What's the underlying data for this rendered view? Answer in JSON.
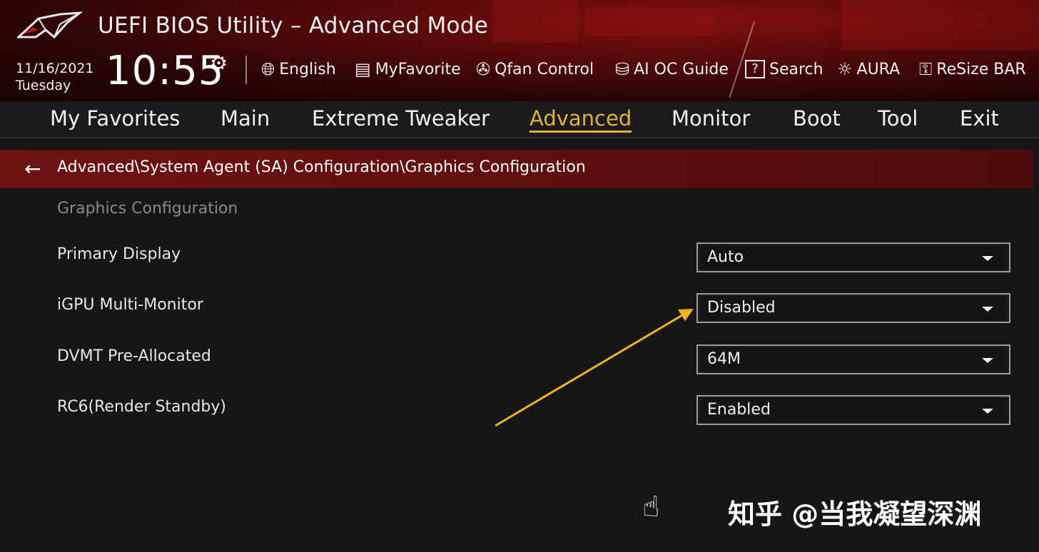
{
  "header": {
    "title": "UEFI BIOS Utility – Advanced Mode",
    "date": "11/16/2021",
    "day": "Tuesday",
    "time": "10:55",
    "tools": [
      {
        "icon": "globe-icon",
        "label": "English"
      },
      {
        "icon": "favorite-list-icon",
        "label": "MyFavorite"
      },
      {
        "icon": "fan-icon",
        "label": "Qfan Control"
      },
      {
        "icon": "ai-oc-icon",
        "label": "AI OC Guide"
      },
      {
        "icon": "question-box-icon",
        "label": "Search"
      },
      {
        "icon": "aura-light-icon",
        "label": "AURA"
      },
      {
        "icon": "resize-bar-icon",
        "label": "ReSize BAR"
      }
    ]
  },
  "nav": {
    "tabs": [
      "My Favorites",
      "Main",
      "Extreme Tweaker",
      "Advanced",
      "Monitor",
      "Boot",
      "Tool",
      "Exit"
    ],
    "active": "Advanced"
  },
  "breadcrumb": {
    "path": "Advanced\\System Agent (SA) Configuration\\Graphics Configuration"
  },
  "content": {
    "section_title": "Graphics Configuration",
    "settings": [
      {
        "label": "Primary Display",
        "value": "Auto"
      },
      {
        "label": "iGPU Multi-Monitor",
        "value": "Disabled"
      },
      {
        "label": "DVMT Pre-Allocated",
        "value": "64M"
      },
      {
        "label": "RC6(Render Standby)",
        "value": "Enabled"
      }
    ]
  },
  "annotation": {
    "arrow_color": "#f5b21c",
    "target": "iGPU Multi-Monitor"
  },
  "watermark": "知乎 @当我凝望深渊",
  "colors": {
    "accent": "#e4b230",
    "breadcrumb_bg": "#6e1212",
    "background": "#161616"
  }
}
